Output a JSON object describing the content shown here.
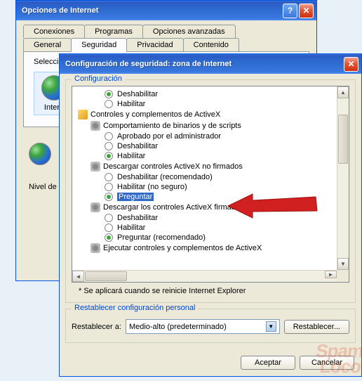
{
  "parent": {
    "title": "Opciones de Internet",
    "tabs_row1": [
      "Conexiones",
      "Programas",
      "Opciones avanzadas"
    ],
    "tabs_row2": [
      "General",
      "Seguridad",
      "Privacidad",
      "Contenido"
    ],
    "active_tab": "Seguridad",
    "select_label": "Seleccio",
    "zone_label": "Intern",
    "level_label": "Nivel de"
  },
  "child": {
    "title": "Configuración de seguridad: zona de Internet",
    "config_label": "Configuración",
    "tree": {
      "g1": {
        "opt_disable": "Deshabilitar",
        "opt_enable": "Habilitar"
      },
      "activex_header": "Controles y complementos de ActiveX",
      "g2": {
        "header": "Comportamiento de binarios y de scripts",
        "opt_admin": "Aprobado por el administrador",
        "opt_disable": "Deshabilitar",
        "opt_enable": "Habilitar"
      },
      "g3": {
        "header": "Descargar controles ActiveX no firmados",
        "opt_disable": "Deshabilitar (recomendado)",
        "opt_enable": "Habilitar (no seguro)",
        "opt_prompt": "Preguntar"
      },
      "g4": {
        "header": "Descargar los controles ActiveX firmados",
        "opt_disable": "Deshabilitar",
        "opt_enable": "Habilitar",
        "opt_prompt": "Preguntar (recomendado)"
      },
      "g5_header": "Ejecutar controles y complementos de ActiveX"
    },
    "asterisk": "* Se aplicará cuando se reinicie Internet Explorer",
    "reset_section": "Restablecer configuración personal",
    "reset_label": "Restablecer a:",
    "reset_select": "Medio-alto (predeterminado)",
    "reset_button": "Restablecer...",
    "ok": "Aceptar",
    "cancel": "Cancelar"
  },
  "watermark": "Spam\nLoco"
}
